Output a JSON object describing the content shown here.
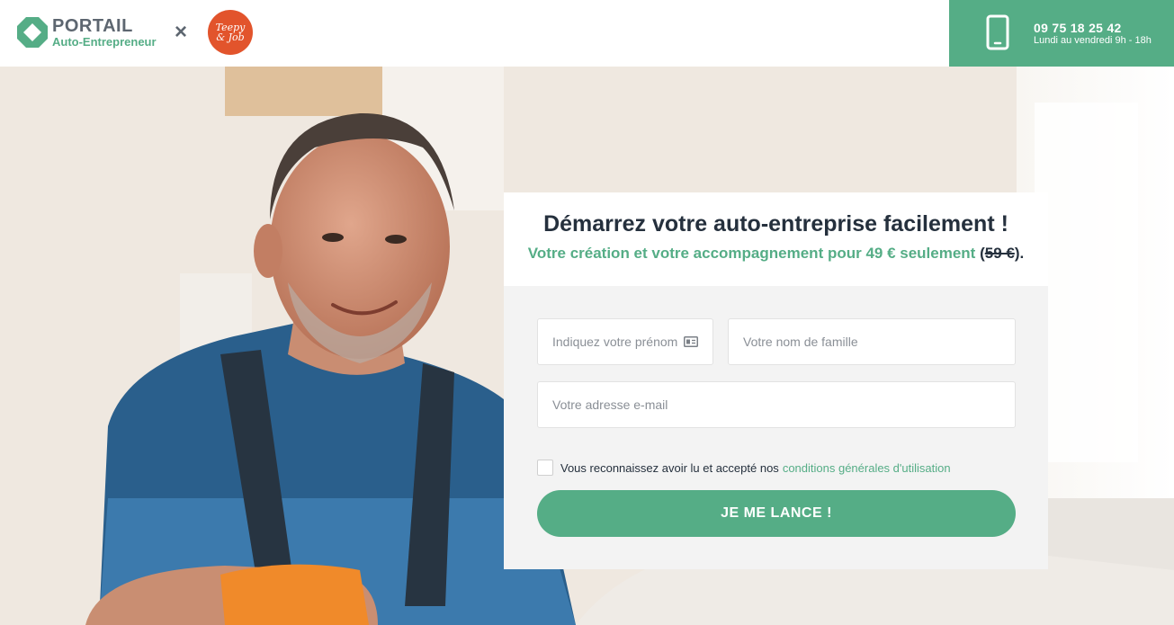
{
  "header": {
    "logo_title": "PORTAIL",
    "logo_subtitle": "Auto-Entrepreneur",
    "separator": "×",
    "partner_line1": "Teepy",
    "partner_line2": "& Job",
    "contact_phone": "09 75 18 25 42",
    "contact_hours": "Lundi au vendredi 9h - 18h"
  },
  "card": {
    "title": "Démarrez votre auto-entreprise facilement !",
    "subtitle_prefix": "Votre création et votre accompagnement pour 49 € seulement",
    "subtitle_paren_open": " (",
    "subtitle_old_price": "59 €",
    "subtitle_paren_close": ")."
  },
  "form": {
    "first_name_placeholder": "Indiquez votre prénom",
    "last_name_placeholder": "Votre nom de famille",
    "email_placeholder": "Votre adresse e-mail",
    "terms_text": "Vous reconnaissez avoir lu et accepté nos",
    "terms_link": "conditions générales d'utilisation",
    "submit_label": "JE ME LANCE !"
  },
  "colors": {
    "brand_green": "#55ad86",
    "dark_text": "#25303d",
    "partner_orange": "#e2542c"
  }
}
